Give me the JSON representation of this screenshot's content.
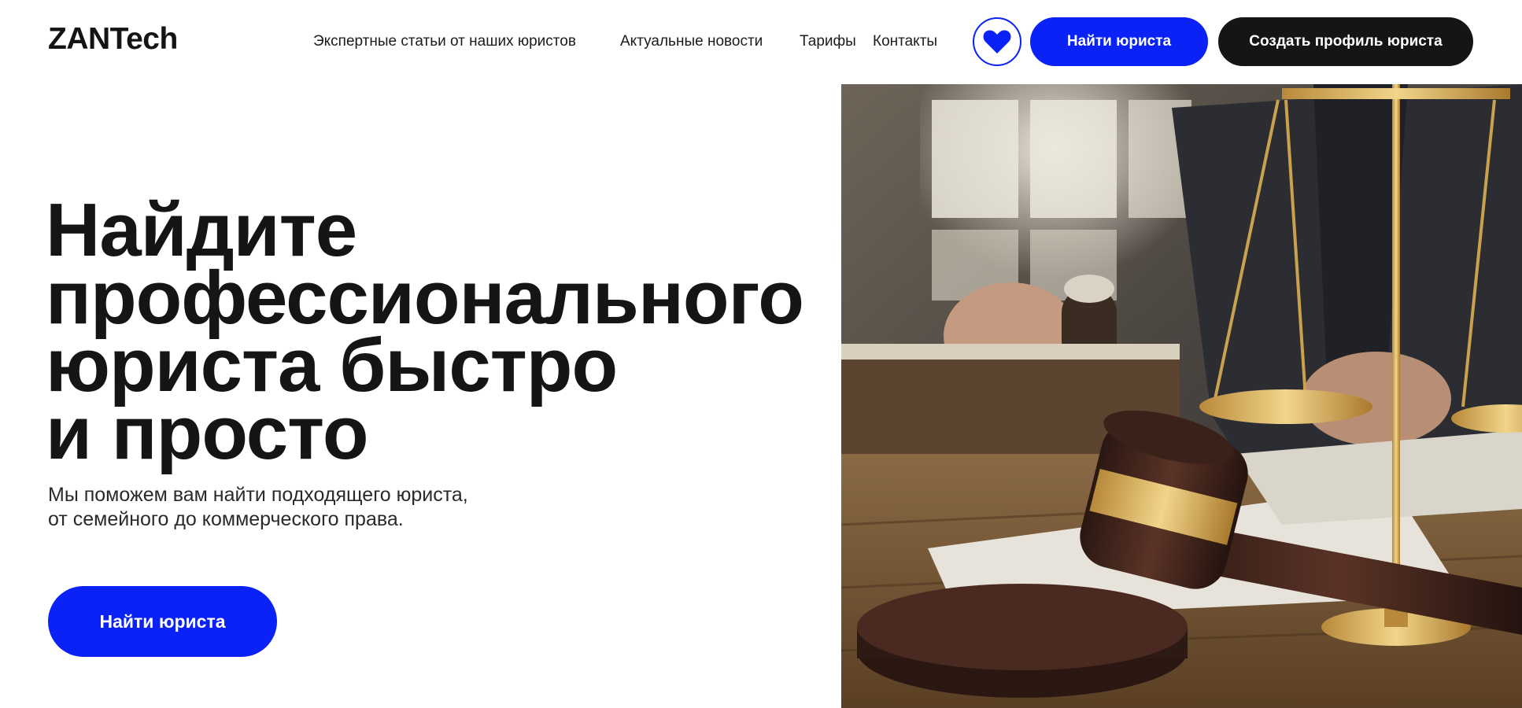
{
  "header": {
    "logo": "ZANTech",
    "nav": [
      {
        "label": "Экспертные статьи от наших юристов"
      },
      {
        "label": "Актуальные новости"
      },
      {
        "label": "Тарифы"
      },
      {
        "label": "Контакты"
      }
    ],
    "favorite_icon": "heart-icon",
    "find_lawyer_label": "Найти юриста",
    "create_profile_label": "Создать профиль юриста"
  },
  "hero": {
    "title_lines": [
      "Найдите",
      "профессионального",
      "юриста быстро",
      "и просто"
    ],
    "subtitle_lines": [
      "Мы поможем вам найти подходящего юриста,",
      "от семейного до коммерческого права."
    ],
    "cta_label": "Найти юриста",
    "image": "gavel-and-scales-photo"
  },
  "colors": {
    "accent": "#0a22f5",
    "dark_button": "#151515",
    "text": "#151515",
    "background": "#ffffff"
  }
}
